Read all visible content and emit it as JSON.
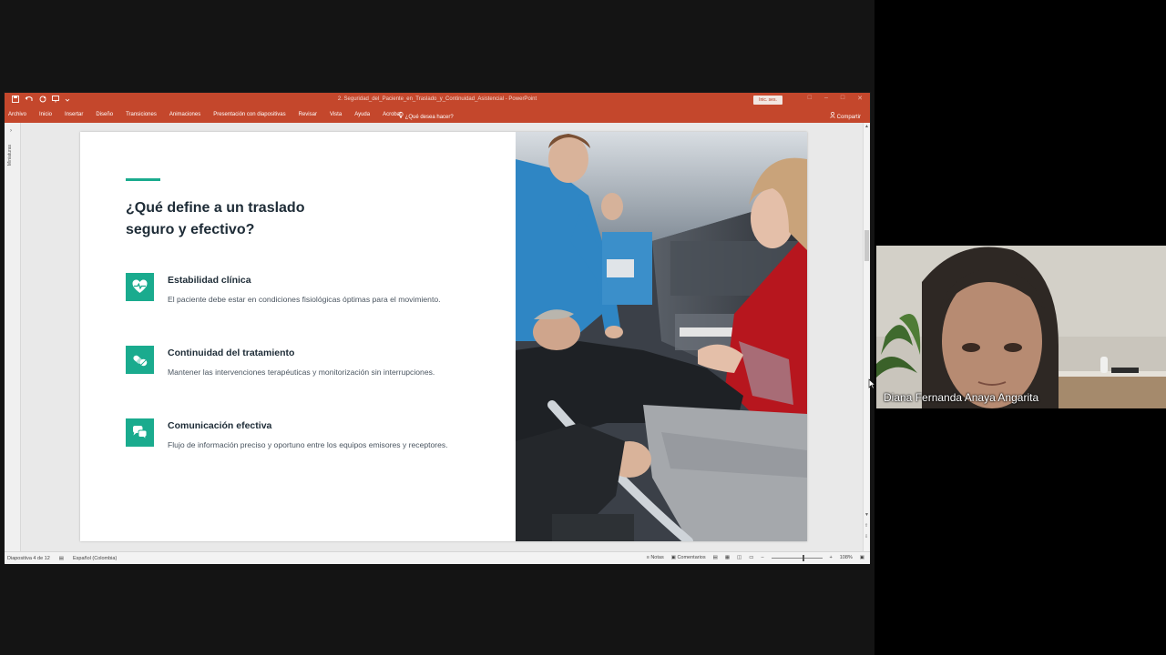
{
  "window": {
    "doc_title": "2. Seguridad_del_Paciente_en_Traslado_y_Continuidad_Asistencial  -  PowerPoint",
    "signin_label": "Inic. ses.",
    "qat_save": "💾",
    "qat_undo": "↶",
    "qat_redo": "↻"
  },
  "ribbon": {
    "tabs": [
      "Archivo",
      "Inicio",
      "Insertar",
      "Diseño",
      "Transiciones",
      "Animaciones",
      "Presentación con diapositivas",
      "Revisar",
      "Vista",
      "Ayuda",
      "Acrobat"
    ],
    "tell_me": "¿Qué desea hacer?",
    "share": "Compartir"
  },
  "thumb_rail": {
    "label": "Miniaturas"
  },
  "slide": {
    "title_line1": "¿Qué define a un traslado",
    "title_line2": "seguro y efectivo?",
    "items": [
      {
        "icon": "heart-pulse-icon",
        "heading": "Estabilidad clínica",
        "text": "El paciente debe estar en condiciones fisiológicas óptimas para el movimiento."
      },
      {
        "icon": "pills-icon",
        "heading": "Continuidad del tratamiento",
        "text": "Mantener las intervenciones terapéuticas y monitorización sin interrupciones."
      },
      {
        "icon": "chat-bubbles-icon",
        "heading": "Comunicación efectiva",
        "text": "Flujo de información preciso y oportuno entre los equipos emisores y receptores."
      }
    ],
    "accent_color": "#1aab8e"
  },
  "statusbar": {
    "slide_counter": "Diapositiva 4 de 12",
    "language": "Español (Colombia)",
    "notes": "Notas",
    "comments": "Comentarios",
    "zoom": "108%"
  },
  "video": {
    "participant_name": "Diana Fernanda Anaya Angarita"
  },
  "colors": {
    "ribbon": "#c4472c",
    "accent": "#1aab8e"
  }
}
